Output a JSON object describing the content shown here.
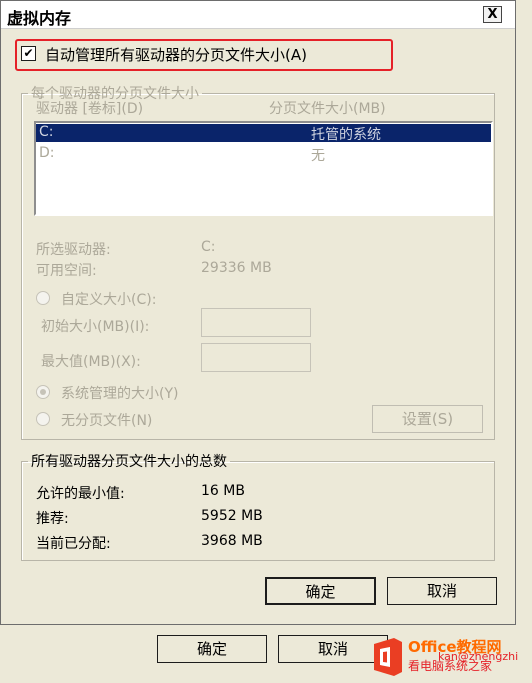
{
  "window": {
    "title": "虚拟内存",
    "close_label": "X"
  },
  "auto_manage": {
    "label": "自动管理所有驱动器的分页文件大小(A)",
    "checked": true
  },
  "per_drive": {
    "legend": "每个驱动器的分页文件大小",
    "col_drive": "驱动器 [卷标](D)",
    "col_size": "分页文件大小(MB)",
    "drives": [
      {
        "drive": "C:",
        "size": "托管的系统",
        "selected": true
      },
      {
        "drive": "D:",
        "size": "无",
        "selected": false
      }
    ],
    "selected_drive_label": "所选驱动器:",
    "selected_drive_value": "C:",
    "free_space_label": "可用空间:",
    "free_space_value": "29336 MB",
    "custom_size_label": "自定义大小(C):",
    "initial_size_label": "初始大小(MB)(I):",
    "initial_size_value": "",
    "max_size_label": "最大值(MB)(X):",
    "max_size_value": "",
    "system_managed_label": "系统管理的大小(Y)",
    "no_paging_label": "无分页文件(N)",
    "set_button": "设置(S)"
  },
  "totals": {
    "legend": "所有驱动器分页文件大小的总数",
    "min_allowed_label": "允许的最小值:",
    "min_allowed_value": "16 MB",
    "recommended_label": "推荐:",
    "recommended_value": "5952 MB",
    "allocated_label": "当前已分配:",
    "allocated_value": "3968 MB"
  },
  "buttons": {
    "ok": "确定",
    "cancel": "取消"
  },
  "background_buttons": {
    "ok": "确定",
    "cancel": "取消"
  },
  "watermark": {
    "line1": "Office教程网",
    "line2": "kan@zhengzhi",
    "line3": "看电脑系统之家"
  },
  "colors": {
    "highlight_border": "#e52128",
    "selection": "#0a246a",
    "watermark_orange": "#ff6a00"
  }
}
